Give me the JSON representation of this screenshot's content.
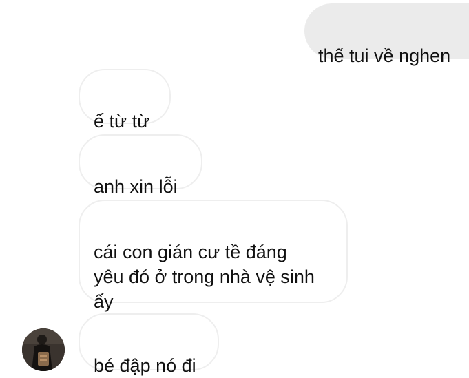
{
  "messages": [
    {
      "id": "m0",
      "direction": "outgoing",
      "text": "thế tui về nghen"
    },
    {
      "id": "m1",
      "direction": "incoming",
      "text": "ế từ từ"
    },
    {
      "id": "m2",
      "direction": "incoming",
      "text": "anh xin lỗi"
    },
    {
      "id": "m3",
      "direction": "incoming",
      "text": "cái con gián cư tề đáng\nyêu đó ở trong nhà vệ sinh\nấy"
    },
    {
      "id": "m4",
      "direction": "incoming",
      "text": "bé đập nó đi"
    }
  ],
  "avatar": {
    "icon": "contact-avatar-photo"
  },
  "colors": {
    "outgoing_bubble": "#ebebeb",
    "incoming_bubble": "#ffffff",
    "incoming_border": "#eeeeee",
    "text": "#111111",
    "background": "#ffffff"
  }
}
